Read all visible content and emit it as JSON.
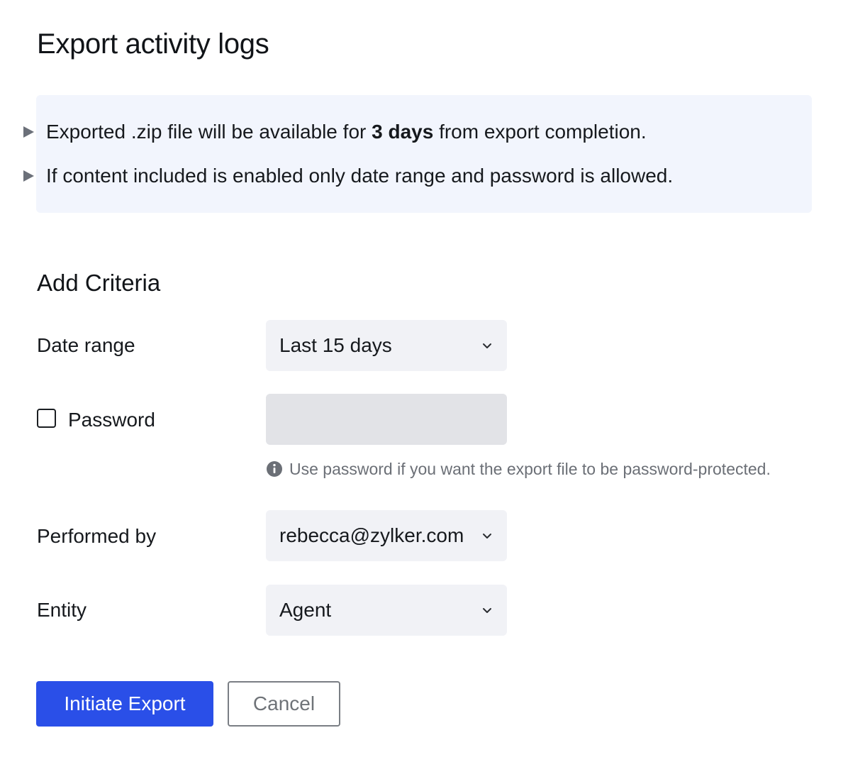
{
  "title": "Export activity logs",
  "notice": {
    "items": [
      {
        "prefix": "Exported .zip file will be available for ",
        "bold": "3 days",
        "suffix": " from export completion.",
        "icon": "triangle-right-icon"
      },
      {
        "text": "If content included is enabled only date range and password is allowed.",
        "icon": "triangle-right-icon"
      }
    ]
  },
  "criteria": {
    "heading": "Add Criteria",
    "date_range": {
      "label": "Date range",
      "value": "Last 15 days"
    },
    "password": {
      "label": "Password",
      "checked": false,
      "value": "",
      "hint": "Use password if you want the export file to be password-protected.",
      "hint_icon": "info-icon"
    },
    "performed_by": {
      "label": "Performed by",
      "value": "rebecca@zylker.com"
    },
    "entity": {
      "label": "Entity",
      "value": "Agent"
    }
  },
  "actions": {
    "primary": "Initiate Export",
    "secondary": "Cancel"
  },
  "colors": {
    "primary": "#2a4fe8",
    "notice_bg": "#f2f5fd",
    "field_bg": "#f1f2f6",
    "disabled_bg": "#e2e3e7"
  }
}
